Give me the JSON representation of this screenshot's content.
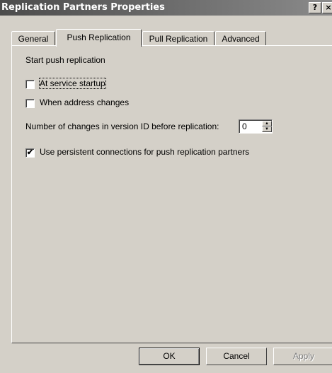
{
  "window": {
    "title": "Replication Partners Properties",
    "help_icon": "?",
    "close_icon": "×"
  },
  "tabs": [
    {
      "label": "General"
    },
    {
      "label": "Push Replication",
      "active": true
    },
    {
      "label": "Pull Replication"
    },
    {
      "label": "Advanced"
    }
  ],
  "push": {
    "section_label": "Start push replication",
    "at_startup": {
      "label": "At service startup",
      "checked": false
    },
    "address_changes": {
      "label": "When address changes",
      "checked": false
    },
    "changes_label": "Number of changes in version ID before replication:",
    "changes_value": "0",
    "persistent": {
      "label": "Use persistent connections for push replication partners",
      "checked": true
    }
  },
  "buttons": {
    "ok": "OK",
    "cancel": "Cancel",
    "apply": "Apply"
  }
}
